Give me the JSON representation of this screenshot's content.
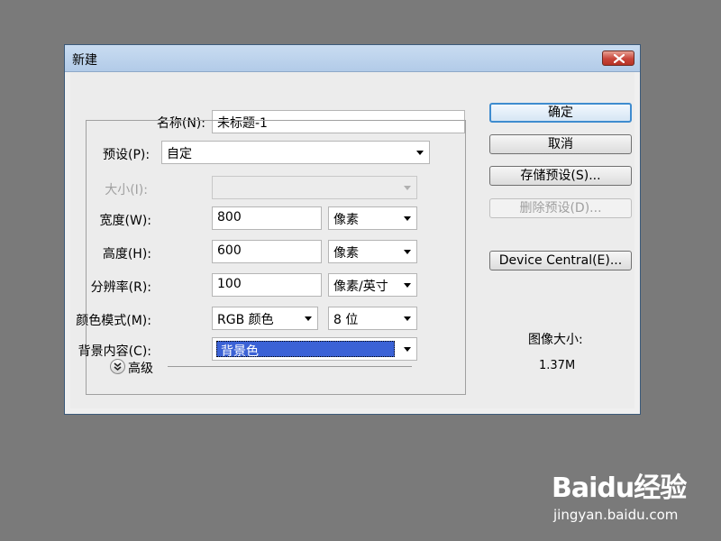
{
  "dialog": {
    "title": "新建",
    "fields": {
      "name": {
        "label": "名称(N):",
        "value": "未标题-1"
      },
      "preset": {
        "label": "预设(P):",
        "value": "自定"
      },
      "size": {
        "label": "大小(I):",
        "value": ""
      },
      "width": {
        "label": "宽度(W):",
        "value": "800",
        "unit": "像素"
      },
      "height": {
        "label": "高度(H):",
        "value": "600",
        "unit": "像素"
      },
      "resolution": {
        "label": "分辨率(R):",
        "value": "100",
        "unit": "像素/英寸"
      },
      "color_mode": {
        "label": "颜色模式(M):",
        "value": "RGB 颜色",
        "depth": "8 位"
      },
      "background": {
        "label": "背景内容(C):",
        "value": "背景色"
      }
    },
    "advanced_label": "高级",
    "buttons": {
      "ok": "确定",
      "cancel": "取消",
      "save_preset": "存储预设(S)...",
      "delete_preset": "删除预设(D)...",
      "device_central": "Device Central(E)..."
    },
    "image_size": {
      "label": "图像大小:",
      "value": "1.37M"
    }
  },
  "watermark": {
    "brand": "Baidu经验",
    "site": "jingyan.baidu.com"
  },
  "colors": {
    "background": "#7a7a7a",
    "accent": "#3b62d6",
    "close": "#c8453a"
  }
}
